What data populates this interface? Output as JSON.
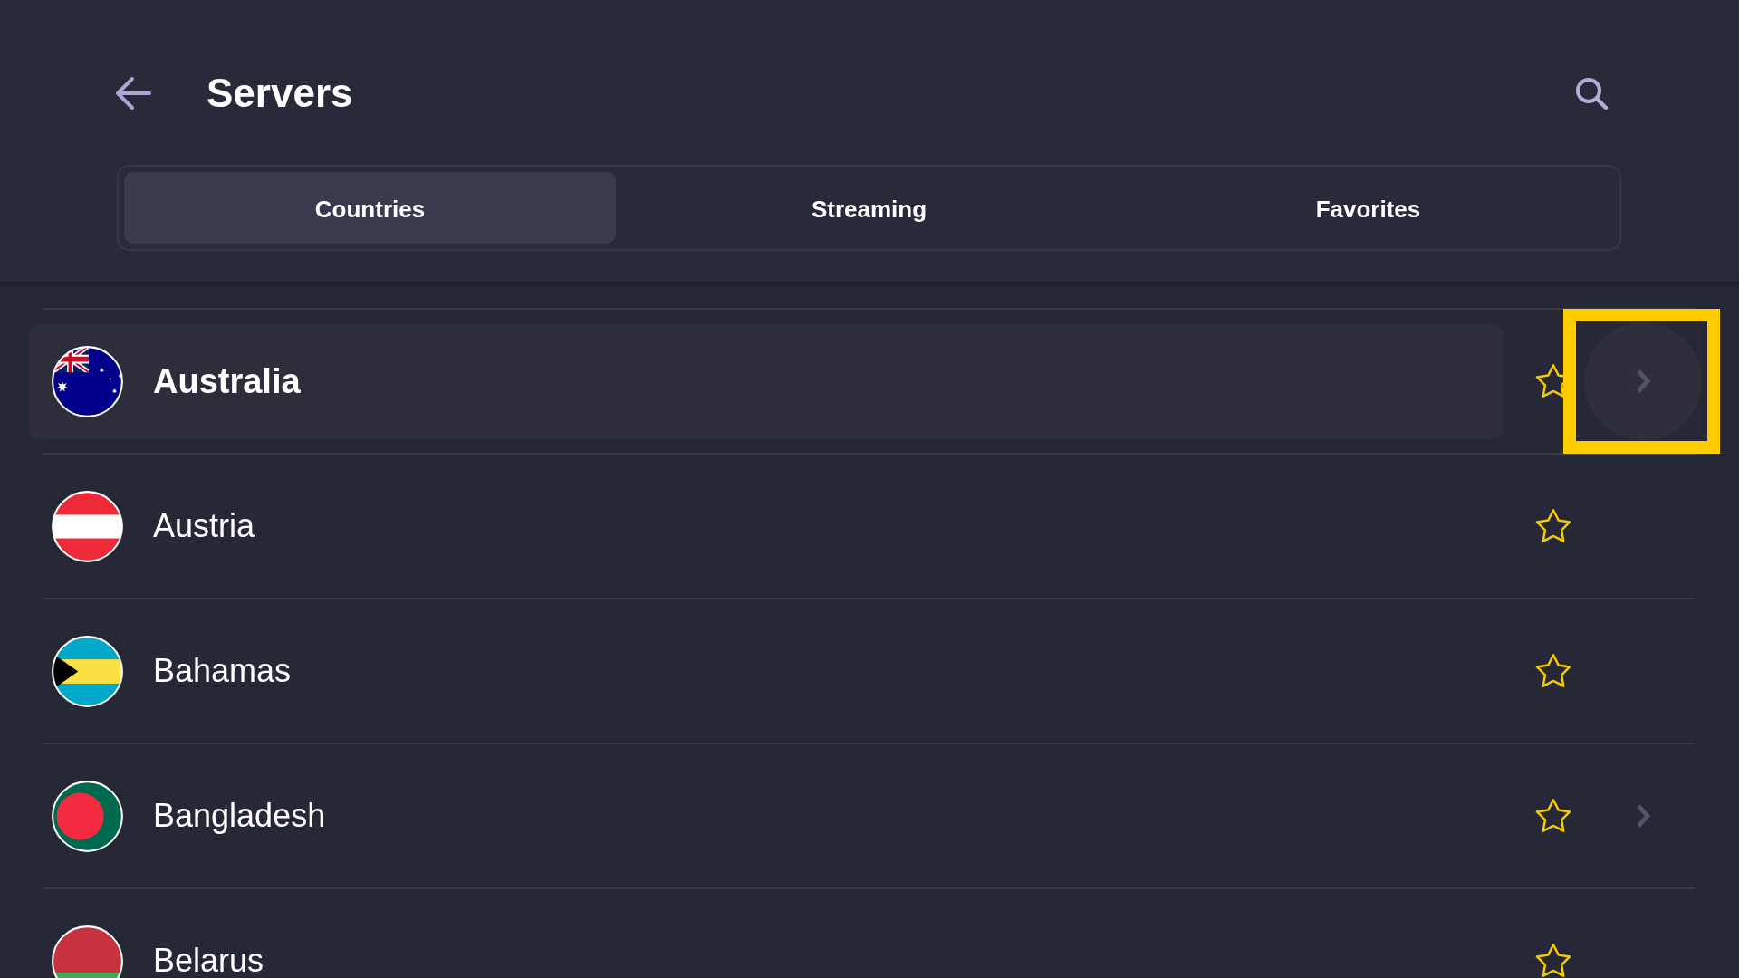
{
  "header": {
    "title": "Servers"
  },
  "tabs": [
    {
      "label": "Countries",
      "selected": true
    },
    {
      "label": "Streaming",
      "selected": false
    },
    {
      "label": "Favorites",
      "selected": false
    }
  ],
  "countries": [
    {
      "name": "Australia",
      "kind": "au",
      "selected": true,
      "favorite": false,
      "expandable": true,
      "focused": true
    },
    {
      "name": "Austria",
      "kind": "at",
      "selected": false,
      "favorite": false,
      "expandable": false,
      "focused": false
    },
    {
      "name": "Bahamas",
      "kind": "bs",
      "selected": false,
      "favorite": false,
      "expandable": false,
      "focused": false
    },
    {
      "name": "Bangladesh",
      "kind": "bd",
      "selected": false,
      "favorite": false,
      "expandable": true,
      "focused": false
    },
    {
      "name": "Belarus",
      "kind": "by",
      "selected": false,
      "favorite": false,
      "expandable": false,
      "focused": false
    }
  ]
}
